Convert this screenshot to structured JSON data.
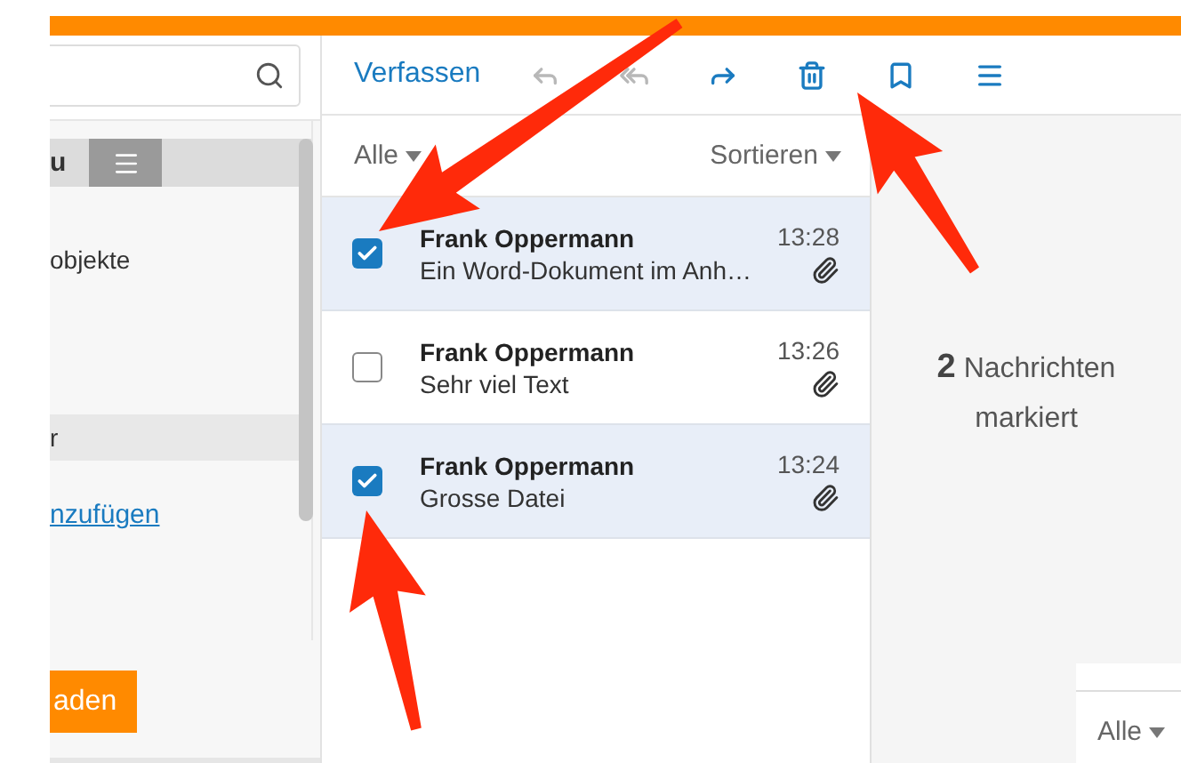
{
  "sidebar": {
    "tab_label": "u",
    "items": [
      {
        "label": "objekte",
        "selected": false
      },
      {
        "label": "r",
        "selected": true
      }
    ],
    "link": "nzufügen",
    "button": "aden"
  },
  "toolbar": {
    "compose": "Verfassen",
    "actions": [
      {
        "kind": "reply",
        "disabled": true
      },
      {
        "kind": "reply-all",
        "disabled": true
      },
      {
        "kind": "forward",
        "disabled": false
      },
      {
        "kind": "delete",
        "disabled": false
      },
      {
        "kind": "bookmark",
        "disabled": false
      },
      {
        "kind": "menu",
        "disabled": false
      }
    ]
  },
  "list": {
    "filter": "Alle",
    "sort": "Sortieren",
    "messages": [
      {
        "sender": "Frank Oppermann",
        "time": "13:28",
        "subject": "Ein Word-Dokument im Anh…",
        "checked": true,
        "attachment": true
      },
      {
        "sender": "Frank Oppermann",
        "time": "13:26",
        "subject": "Sehr viel Text",
        "checked": false,
        "attachment": true
      },
      {
        "sender": "Frank Oppermann",
        "time": "13:24",
        "subject": "Grosse Datei",
        "checked": true,
        "attachment": true
      }
    ]
  },
  "preview": {
    "summary": "**2** Nachrichten markiert",
    "filter": "Alle"
  }
}
